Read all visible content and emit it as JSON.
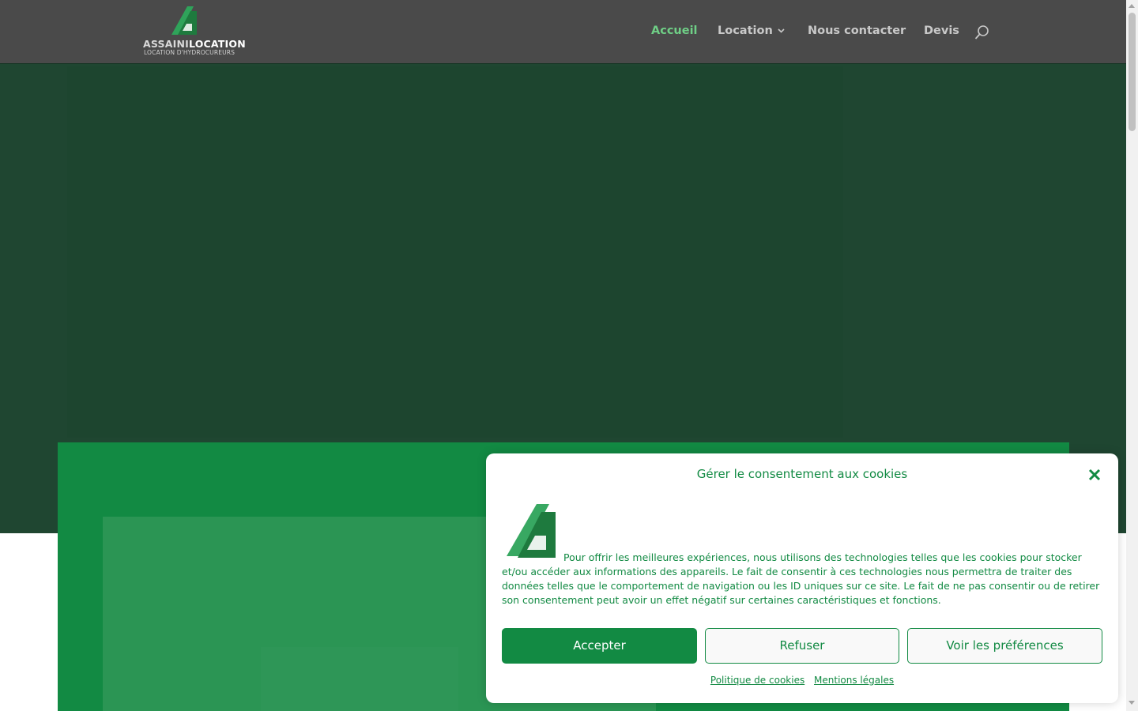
{
  "header": {
    "logo": {
      "name_part_a": "ASSAINI",
      "name_part_b": "LOCATION",
      "tagline": "LOCATION D'HYDROCUREURS"
    },
    "nav": {
      "home": "Accueil",
      "location": "Location",
      "contact": "Nous contacter",
      "devis": "Devis"
    },
    "search_icon": "search-icon"
  },
  "cookie_banner": {
    "title": "Gérer le consentement aux cookies",
    "close_icon": "close-icon",
    "body": "Pour offrir les meilleures expériences, nous utilisons des technologies telles que les cookies pour stocker et/ou accéder aux informations des appareils. Le fait de consentir à ces technologies nous permettra de traiter des données telles que le comportement de navigation ou les ID uniques sur ce site. Le fait de ne pas consentir ou de retirer son consentement peut avoir un effet négatif sur certaines caractéristiques et fonctions.",
    "buttons": {
      "accept": "Accepter",
      "refuse": "Refuser",
      "preferences": "Voir les préférences"
    },
    "links": {
      "cookie_policy": "Politique de cookies",
      "legal": "Mentions légales"
    }
  },
  "colors": {
    "header_bg": "#4a4a4a",
    "nav_active": "#6fcf86",
    "brand_green": "#128a43",
    "hero_bg": "#1f4631"
  }
}
